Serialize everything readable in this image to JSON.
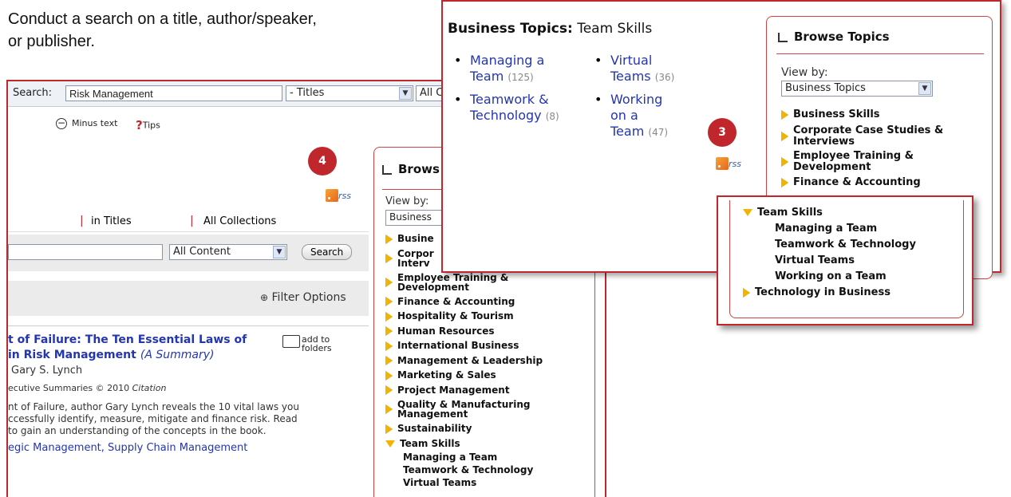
{
  "intro_text": [
    "Conduct a search on a title, author/speaker,",
    "or publisher."
  ],
  "base": {
    "search_label": "Search:",
    "search_value": "Risk Management",
    "search_type": "- Titles",
    "collection_select": "All C",
    "minus_text": "Minus text",
    "tips": "Tips",
    "step4": "4",
    "rss": "rss",
    "tabs": [
      "in Titles",
      "All Collections"
    ],
    "content_select": "All Content",
    "search_button": "Search",
    "filter_options": "Filter Options",
    "result": {
      "title_line1": "t of Failure: The Ten Essential Laws of",
      "title_line2": "in Risk Management",
      "title_suffix": "(A Summary)",
      "author": "Gary S. Lynch",
      "source": "ecutive Summaries © 2010",
      "source_italic": "Citation",
      "desc": [
        "nt of Failure, author Gary Lynch reveals the 10 vital laws you",
        "ccessfully identify, measure, mitigate and finance risk. Read",
        "to gain an understanding of the concepts in the book."
      ],
      "tags": "egic Management, Supply Chain Management",
      "add_folders": [
        "add to",
        "folders"
      ]
    },
    "browse": {
      "title": "Brows",
      "view_by": "View by:",
      "select": "Business",
      "topics": [
        {
          "label": "Busine",
          "open": false
        },
        {
          "label": "Corpor",
          "label2": "Interv",
          "open": false
        },
        {
          "label": "Employee Training &",
          "label2": "Development",
          "open": false
        },
        {
          "label": "Finance & Accounting",
          "open": false
        },
        {
          "label": "Hospitality & Tourism",
          "open": false
        },
        {
          "label": "Human Resources",
          "open": false
        },
        {
          "label": "International Business",
          "open": false
        },
        {
          "label": "Management & Leadership",
          "open": false
        },
        {
          "label": "Marketing & Sales",
          "open": false
        },
        {
          "label": "Project Management",
          "open": false
        },
        {
          "label": "Quality & Manufacturing",
          "label2": "Management",
          "open": false
        },
        {
          "label": "Sustainability",
          "open": false
        },
        {
          "label": "Team Skills",
          "open": true
        }
      ],
      "subtopics": [
        "Managing a Team",
        "Teamwork & Technology",
        "Virtual Teams"
      ]
    }
  },
  "overlay1": {
    "heading_bold": "Business Topics:",
    "heading_rest": "Team Skills",
    "col1": [
      {
        "l1": "Managing a",
        "l2": "Team",
        "count": "(125)"
      },
      {
        "l1": "Teamwork &",
        "l2": "Technology",
        "count": "(8)"
      }
    ],
    "col2": [
      {
        "l1": "Virtual",
        "l2": "Teams",
        "count": "(36)"
      },
      {
        "l1": "Working",
        "l2": "on a",
        "l3": "Team",
        "count": "(47)"
      }
    ],
    "step3": "3",
    "rss": "rss",
    "browse": {
      "title": "Browse Topics",
      "view_by": "View by:",
      "select": "Business Topics",
      "topics": [
        {
          "label": "Business Skills"
        },
        {
          "label": "Corporate Case Studies &",
          "label2": "Interviews"
        },
        {
          "label": "Employee Training &",
          "label2": "Development"
        },
        {
          "label": "Finance & Accounting"
        }
      ]
    }
  },
  "overlay2": {
    "open_topic": "Team Skills",
    "subtopics": [
      "Managing a Team",
      "Teamwork & Technology",
      "Virtual Teams",
      "Working on a Team"
    ],
    "next_topic": "Technology in Business"
  }
}
